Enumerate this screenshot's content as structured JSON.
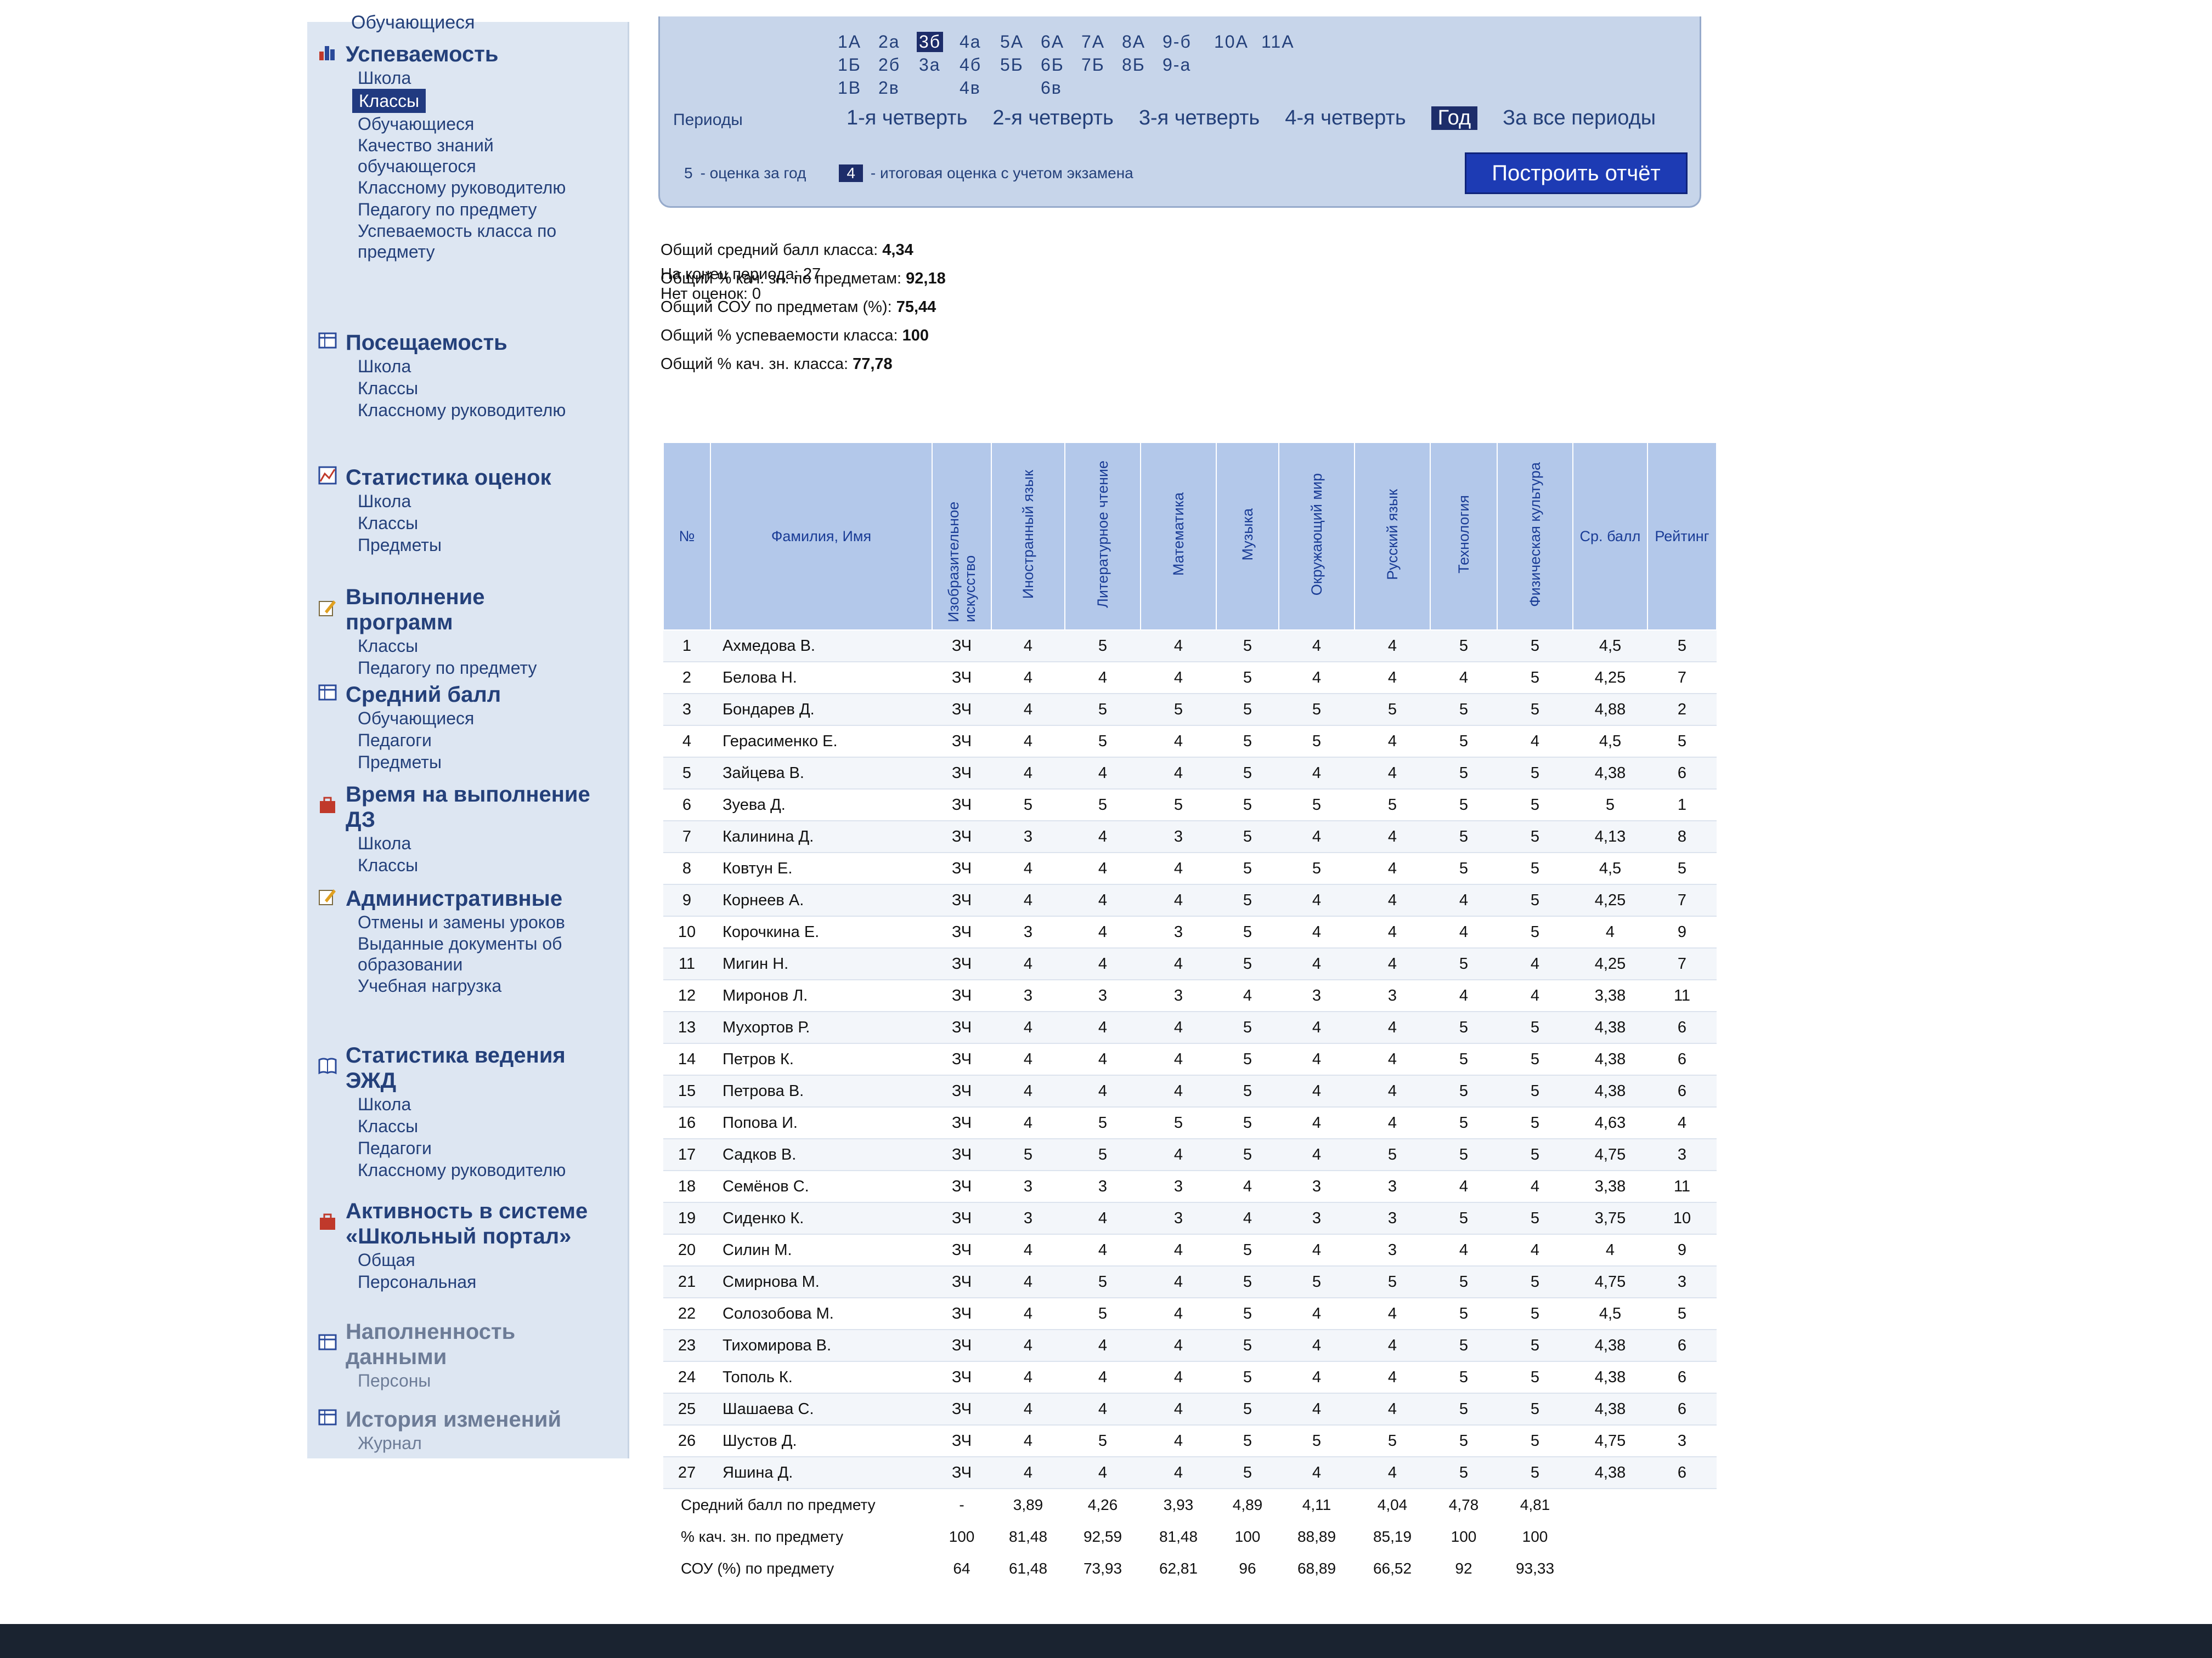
{
  "sidebar": {
    "cut_item": "Обучающиеся",
    "sections": [
      {
        "title": "Успеваемость",
        "icon": "bar-chart-icon",
        "faded": false,
        "items": [
          {
            "label": "Школа"
          },
          {
            "label": "Классы",
            "active": true
          },
          {
            "label": "Обучающиеся"
          },
          {
            "label": "Качество знаний обучающегося"
          },
          {
            "label": "Классному руководителю"
          },
          {
            "label": "Педагогу по предмету"
          },
          {
            "label": "Успеваемость класса по предмету"
          }
        ]
      },
      {
        "title": "Посещаемость",
        "icon": "table-icon",
        "faded": false,
        "items": [
          {
            "label": "Школа"
          },
          {
            "label": "Классы"
          },
          {
            "label": "Классному руководителю"
          }
        ]
      },
      {
        "title": "Статистика оценок",
        "icon": "stats-icon",
        "faded": false,
        "items": [
          {
            "label": "Школа"
          },
          {
            "label": "Классы"
          },
          {
            "label": "Предметы"
          }
        ]
      },
      {
        "title": "Выполнение программ",
        "icon": "pencil-icon",
        "faded": false,
        "items": [
          {
            "label": "Классы"
          },
          {
            "label": "Педагогу по предмету"
          }
        ]
      },
      {
        "title": "Средний балл",
        "icon": "table-icon",
        "faded": false,
        "items": [
          {
            "label": "Обучающиеся"
          },
          {
            "label": "Педагоги"
          },
          {
            "label": "Предметы"
          }
        ]
      },
      {
        "title": "Время на выполнение ДЗ",
        "icon": "briefcase-icon",
        "faded": false,
        "items": [
          {
            "label": "Школа"
          },
          {
            "label": "Классы"
          }
        ]
      },
      {
        "title": "Административные",
        "icon": "pencil-icon",
        "faded": false,
        "items": [
          {
            "label": "Отмены и замены уроков"
          },
          {
            "label": "Выданные документы об образовании"
          },
          {
            "label": "Учебная нагрузка"
          }
        ]
      },
      {
        "title": "Статистика ведения ЭЖД",
        "icon": "book-icon",
        "faded": false,
        "items": [
          {
            "label": "Школа"
          },
          {
            "label": "Классы"
          },
          {
            "label": "Педагоги"
          },
          {
            "label": "Классному руководителю"
          }
        ]
      },
      {
        "title": "Активность в системе «Школьный портал»",
        "icon": "briefcase-icon",
        "faded": false,
        "items": [
          {
            "label": "Общая"
          },
          {
            "label": "Персональная"
          }
        ]
      },
      {
        "title": "Наполненность данными",
        "icon": "table-icon",
        "faded": true,
        "items": [
          {
            "label": "Персоны"
          }
        ]
      },
      {
        "title": "История изменений",
        "icon": "table-icon",
        "faded": true,
        "items": [
          {
            "label": "Журнал"
          }
        ]
      }
    ]
  },
  "classes": {
    "rows": [
      [
        "1А",
        "2а",
        "3б",
        "4а",
        "5А",
        "6А",
        "7А",
        "8А",
        "9-б",
        "10А",
        "11А"
      ],
      [
        "1Б",
        "2б",
        "3а",
        "4б",
        "5Б",
        "6Б",
        "7Б",
        "8Б",
        "9-а"
      ],
      [
        "1В",
        "2в",
        "",
        "4в",
        "",
        "6в"
      ]
    ],
    "selected": "3б"
  },
  "periods": {
    "label": "Периоды",
    "items": [
      "1-я четверть",
      "2-я четверть",
      "3-я четверть",
      "4-я четверть",
      "Год",
      "За все периоды"
    ],
    "selected": "Год"
  },
  "legend": {
    "year_mark": "5",
    "year_text": "- оценка за год",
    "exam_mark": "4",
    "exam_text": "- итоговая оценка с учетом экзамена"
  },
  "build_button": "Построить отчёт",
  "summary": [
    {
      "label": "Общий средний балл класса:",
      "value": "4,34"
    },
    {
      "label": "Общий % кач. зн. по предметам:",
      "value": "92,18"
    },
    {
      "label": "Общий СОУ по предметам (%):",
      "value": "75,44"
    },
    {
      "label": "Общий % успеваемости класса:",
      "value": "100"
    },
    {
      "label": "Общий % кач. зн. класса:",
      "value": "77,78"
    }
  ],
  "period_end": "На конец периода: 27",
  "no_marks": "Нет оценок: 0",
  "table": {
    "headers": [
      "№",
      "Фамилия, Имя",
      "Изобразительное искусство",
      "Иностранный язык",
      "Литературное чтение",
      "Математика",
      "Музыка",
      "Окружающий мир",
      "Русский язык",
      "Технология",
      "Физическая культура",
      "Ср. балл",
      "Рейтинг"
    ],
    "rows": [
      [
        "1",
        "Ахмедова В.",
        "ЗЧ",
        "4",
        "5",
        "4",
        "5",
        "4",
        "4",
        "5",
        "5",
        "4,5",
        "5"
      ],
      [
        "2",
        "Белова Н.",
        "ЗЧ",
        "4",
        "4",
        "4",
        "5",
        "4",
        "4",
        "4",
        "5",
        "4,25",
        "7"
      ],
      [
        "3",
        "Бондарев Д.",
        "ЗЧ",
        "4",
        "5",
        "5",
        "5",
        "5",
        "5",
        "5",
        "5",
        "4,88",
        "2"
      ],
      [
        "4",
        "Герасименко Е.",
        "ЗЧ",
        "4",
        "5",
        "4",
        "5",
        "5",
        "4",
        "5",
        "4",
        "4,5",
        "5"
      ],
      [
        "5",
        "Зайцева В.",
        "ЗЧ",
        "4",
        "4",
        "4",
        "5",
        "4",
        "4",
        "5",
        "5",
        "4,38",
        "6"
      ],
      [
        "6",
        "Зуева Д.",
        "ЗЧ",
        "5",
        "5",
        "5",
        "5",
        "5",
        "5",
        "5",
        "5",
        "5",
        "1"
      ],
      [
        "7",
        "Калинина Д.",
        "ЗЧ",
        "3",
        "4",
        "3",
        "5",
        "4",
        "4",
        "5",
        "5",
        "4,13",
        "8"
      ],
      [
        "8",
        "Ковтун Е.",
        "ЗЧ",
        "4",
        "4",
        "4",
        "5",
        "5",
        "4",
        "5",
        "5",
        "4,5",
        "5"
      ],
      [
        "9",
        "Корнеев А.",
        "ЗЧ",
        "4",
        "4",
        "4",
        "5",
        "4",
        "4",
        "4",
        "5",
        "4,25",
        "7"
      ],
      [
        "10",
        "Корочкина Е.",
        "ЗЧ",
        "3",
        "4",
        "3",
        "5",
        "4",
        "4",
        "4",
        "5",
        "4",
        "9"
      ],
      [
        "11",
        "Мигин Н.",
        "ЗЧ",
        "4",
        "4",
        "4",
        "5",
        "4",
        "4",
        "5",
        "4",
        "4,25",
        "7"
      ],
      [
        "12",
        "Миронов Л.",
        "ЗЧ",
        "3",
        "3",
        "3",
        "4",
        "3",
        "3",
        "4",
        "4",
        "3,38",
        "11"
      ],
      [
        "13",
        "Мухортов Р.",
        "ЗЧ",
        "4",
        "4",
        "4",
        "5",
        "4",
        "4",
        "5",
        "5",
        "4,38",
        "6"
      ],
      [
        "14",
        "Петров К.",
        "ЗЧ",
        "4",
        "4",
        "4",
        "5",
        "4",
        "4",
        "5",
        "5",
        "4,38",
        "6"
      ],
      [
        "15",
        "Петрова В.",
        "ЗЧ",
        "4",
        "4",
        "4",
        "5",
        "4",
        "4",
        "5",
        "5",
        "4,38",
        "6"
      ],
      [
        "16",
        "Попова И.",
        "ЗЧ",
        "4",
        "5",
        "5",
        "5",
        "4",
        "4",
        "5",
        "5",
        "4,63",
        "4"
      ],
      [
        "17",
        "Садков В.",
        "ЗЧ",
        "5",
        "5",
        "4",
        "5",
        "4",
        "5",
        "5",
        "5",
        "4,75",
        "3"
      ],
      [
        "18",
        "Семёнов С.",
        "ЗЧ",
        "3",
        "3",
        "3",
        "4",
        "3",
        "3",
        "4",
        "4",
        "3,38",
        "11"
      ],
      [
        "19",
        "Сиденко К.",
        "ЗЧ",
        "3",
        "4",
        "3",
        "4",
        "3",
        "3",
        "5",
        "5",
        "3,75",
        "10"
      ],
      [
        "20",
        "Силин М.",
        "ЗЧ",
        "4",
        "4",
        "4",
        "5",
        "4",
        "3",
        "4",
        "4",
        "4",
        "9"
      ],
      [
        "21",
        "Смирнова М.",
        "ЗЧ",
        "4",
        "5",
        "4",
        "5",
        "5",
        "5",
        "5",
        "5",
        "4,75",
        "3"
      ],
      [
        "22",
        "Солозобова М.",
        "ЗЧ",
        "4",
        "5",
        "4",
        "5",
        "4",
        "4",
        "5",
        "5",
        "4,5",
        "5"
      ],
      [
        "23",
        "Тихомирова В.",
        "ЗЧ",
        "4",
        "4",
        "4",
        "5",
        "4",
        "4",
        "5",
        "5",
        "4,38",
        "6"
      ],
      [
        "24",
        "Тополь К.",
        "ЗЧ",
        "4",
        "4",
        "4",
        "5",
        "4",
        "4",
        "5",
        "5",
        "4,38",
        "6"
      ],
      [
        "25",
        "Шашаева С.",
        "ЗЧ",
        "4",
        "4",
        "4",
        "5",
        "4",
        "4",
        "5",
        "5",
        "4,38",
        "6"
      ],
      [
        "26",
        "Шустов Д.",
        "ЗЧ",
        "4",
        "5",
        "4",
        "5",
        "5",
        "5",
        "5",
        "5",
        "4,75",
        "3"
      ],
      [
        "27",
        "Яшина Д.",
        "ЗЧ",
        "4",
        "4",
        "4",
        "5",
        "4",
        "4",
        "5",
        "5",
        "4,38",
        "6"
      ]
    ],
    "footer": [
      {
        "label": "Средний балл по предмету",
        "values": [
          "-",
          "3,89",
          "4,26",
          "3,93",
          "4,89",
          "4,11",
          "4,04",
          "4,78",
          "4,81"
        ]
      },
      {
        "label": "% кач. зн. по предмету",
        "values": [
          "100",
          "81,48",
          "92,59",
          "81,48",
          "100",
          "88,89",
          "85,19",
          "100",
          "100"
        ]
      },
      {
        "label": "СОУ (%) по предмету",
        "values": [
          "64",
          "61,48",
          "73,93",
          "62,81",
          "96",
          "68,89",
          "66,52",
          "92",
          "93,33"
        ]
      }
    ]
  }
}
